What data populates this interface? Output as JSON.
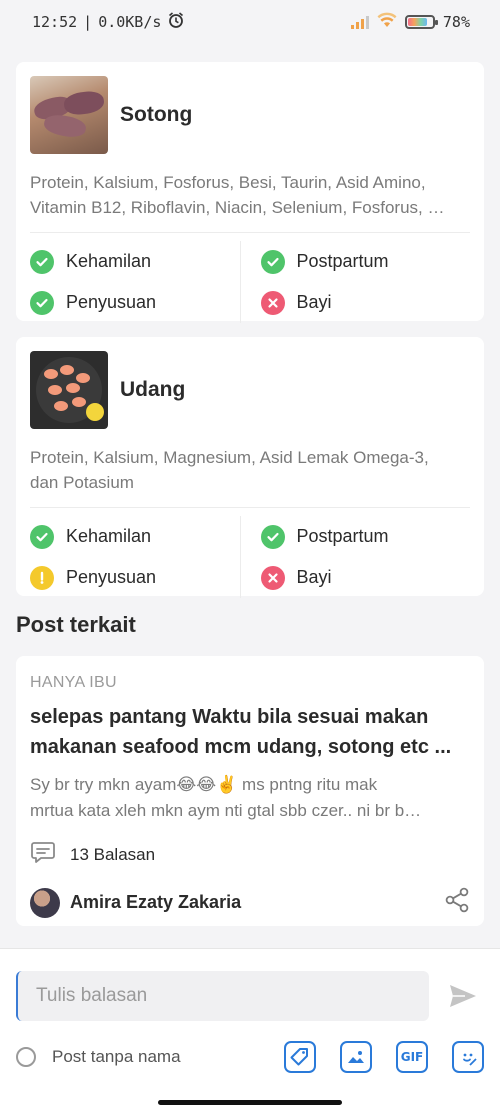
{
  "status_bar": {
    "time": "12:52",
    "net_speed": "0.0KB/s",
    "battery": "78%"
  },
  "foods": [
    {
      "name": "Sotong",
      "nutrients_line1": "Protein, Kalsium, Fosforus, Besi, Taurin, Asid Amino,",
      "nutrients_line2": "Vitamin B12, Riboflavin, Niacin, Selenium, Fosforus, …",
      "status": [
        {
          "label": "Kehamilan",
          "state": "ok"
        },
        {
          "label": "Postpartum",
          "state": "ok"
        },
        {
          "label": "Penyusuan",
          "state": "ok"
        },
        {
          "label": "Bayi",
          "state": "no"
        }
      ]
    },
    {
      "name": "Udang",
      "nutrients_line1": "Protein, Kalsium, Magnesium, Asid Lemak Omega-3,",
      "nutrients_line2": "dan Potasium",
      "status": [
        {
          "label": "Kehamilan",
          "state": "ok"
        },
        {
          "label": "Postpartum",
          "state": "ok"
        },
        {
          "label": "Penyusuan",
          "state": "warn"
        },
        {
          "label": "Bayi",
          "state": "no"
        }
      ]
    }
  ],
  "related": {
    "section_title": "Post terkait",
    "post": {
      "category": "HANYA IBU",
      "title_line1": "selepas pantang Waktu bila sesuai makan",
      "title_line2": "makanan seafood mcm udang, sotong etc ...",
      "body_line1": "Sy br try mkn ayam😂😂✌️ ms pntng ritu mak",
      "body_line2": "mrtua kata xleh mkn aym nti gtal sbb czer.. ni br b…",
      "replies": "13 Balasan",
      "author": "Amira Ezaty Zakaria"
    }
  },
  "composer": {
    "placeholder": "Tulis balasan",
    "anonymous_label": "Post tanpa nama",
    "gif_label": "GIF"
  },
  "colors": {
    "ok": "#4fc46a",
    "no": "#ee5a74",
    "warn": "#f4c92c",
    "accent": "#2a7ad9"
  }
}
